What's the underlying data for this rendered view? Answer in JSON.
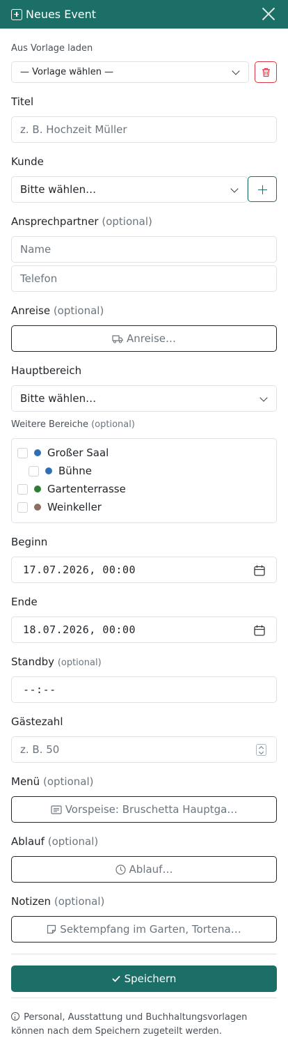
{
  "header": {
    "title": "Neues Event",
    "icon": "calendar-plus-icon"
  },
  "vorlage": {
    "label": "Aus Vorlage laden",
    "selected": "— Vorlage wählen —"
  },
  "titel": {
    "label": "Titel",
    "placeholder": "z. B. Hochzeit Müller"
  },
  "kunde": {
    "label": "Kunde",
    "selected": "Bitte wählen…"
  },
  "ansprechpartner": {
    "label": "Ansprechpartner",
    "optional": "(optional)",
    "name_placeholder": "Name",
    "telefon_placeholder": "Telefon"
  },
  "anreise": {
    "label": "Anreise",
    "optional": "(optional)",
    "button": "Anreise…"
  },
  "hauptbereich": {
    "label": "Hauptbereich",
    "selected": "Bitte wählen…"
  },
  "weitere": {
    "label": "Weitere Bereiche",
    "optional": "(optional)",
    "items": [
      {
        "name": "Großer Saal",
        "color": "#2f6fb5",
        "indent": 0
      },
      {
        "name": "Bühne",
        "color": "#2f6fb5",
        "indent": 1
      },
      {
        "name": "Gartenterrasse",
        "color": "#2e7d32",
        "indent": 0
      },
      {
        "name": "Weinkeller",
        "color": "#8d6e63",
        "indent": 0
      }
    ]
  },
  "beginn": {
    "label": "Beginn",
    "value": "17.07.2026, 00:00"
  },
  "ende": {
    "label": "Ende",
    "value": "18.07.2026, 00:00"
  },
  "standby": {
    "label": "Standby",
    "optional": "(optional)",
    "value": "--:--"
  },
  "gaeste": {
    "label": "Gästezahl",
    "placeholder": "z. B. 50"
  },
  "menue": {
    "label": "Menü",
    "optional": "(optional)",
    "button": "Vorspeise: Bruschetta Hauptga…"
  },
  "ablauf": {
    "label": "Ablauf",
    "optional": "(optional)",
    "button": "Ablauf…"
  },
  "notizen": {
    "label": "Notizen",
    "optional": "(optional)",
    "button": "Sektempfang im Garten, Tortena…"
  },
  "save": {
    "label": "Speichern"
  },
  "footnote": "Personal, Ausstattung und Buchhaltungsvorlagen können nach dem Speichern zugeteilt werden."
}
